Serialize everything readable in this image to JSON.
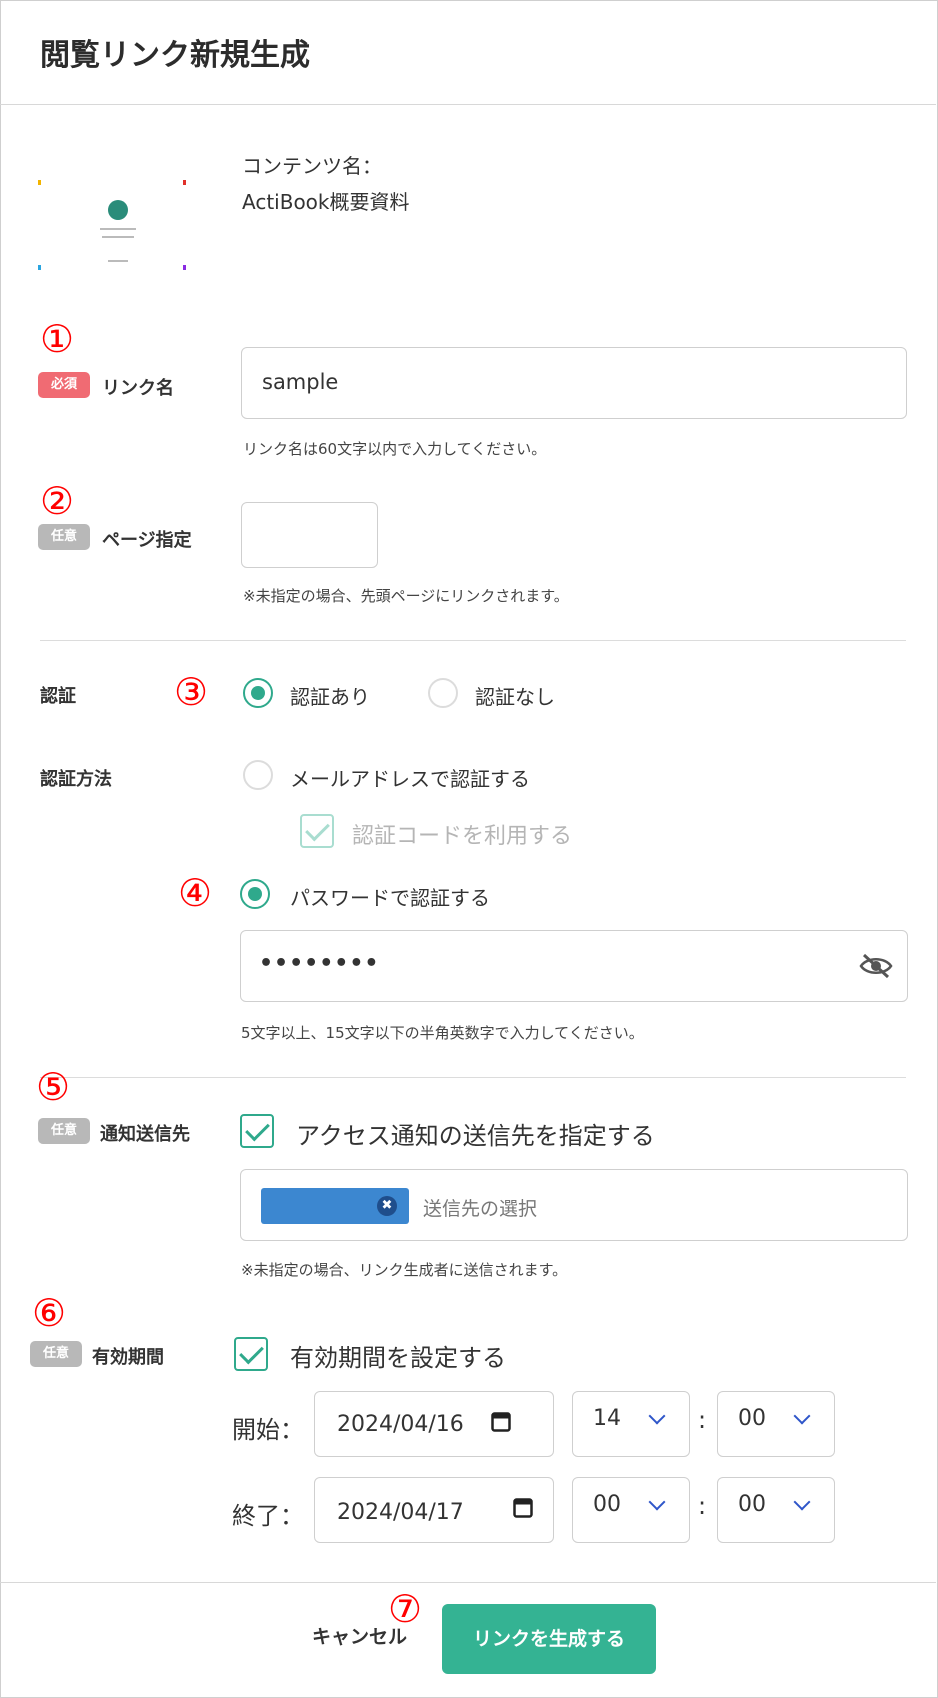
{
  "dialog": {
    "title": "閲覧リンク新規生成"
  },
  "content": {
    "label": "コンテンツ名：",
    "name": "ActiBook概要資料"
  },
  "badges": {
    "required": "必須",
    "optional": "任意"
  },
  "annotations": [
    "①",
    "②",
    "③",
    "④",
    "⑤",
    "⑥",
    "⑦"
  ],
  "link_name": {
    "label": "リンク名",
    "value": "sample",
    "help": "リンク名は60文字以内で入力してください。"
  },
  "page": {
    "label": "ページ指定",
    "value": "",
    "help": "※未指定の場合、先頭ページにリンクされます。"
  },
  "auth": {
    "label": "認証",
    "with": "認証あり",
    "without": "認証なし",
    "selected": "with"
  },
  "auth_method": {
    "label": "認証方法",
    "email": "メールアドレスで認証する",
    "code": "認証コードを利用する",
    "password": "パスワードで認証する",
    "password_value": "••••••••",
    "help": "5文字以上、15文字以下の半角英数字で入力してください。"
  },
  "notify": {
    "label": "通知送信先",
    "checkbox": "アクセス通知の送信先を指定する",
    "placeholder": "送信先の選択",
    "help": "※未指定の場合、リンク生成者に送信されます。"
  },
  "validity": {
    "label": "有効期間",
    "checkbox": "有効期間を設定する",
    "start_label": "開始：",
    "end_label": "終了：",
    "colon": ":",
    "start": {
      "date": "2024/04/16",
      "hour": "14",
      "minute": "00"
    },
    "end": {
      "date": "2024/04/17",
      "hour": "00",
      "minute": "00"
    }
  },
  "footer": {
    "cancel": "キャンセル",
    "submit": "リンクを生成する"
  },
  "colors": {
    "accent": "#34b393",
    "required": "#f06b73",
    "optional": "#b8b8b8",
    "annotation": "#ff0000",
    "tag": "#3c87d0"
  }
}
